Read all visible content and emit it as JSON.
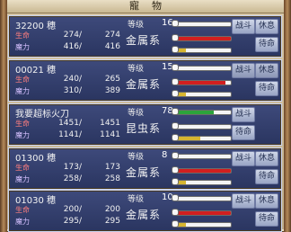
{
  "window": {
    "title": "寵物"
  },
  "labels": {
    "hp": "生命",
    "mp": "魔力",
    "level": "等级"
  },
  "buttons": {
    "battle": "战斗",
    "rest": "休息",
    "standby": "待命"
  },
  "colors": {
    "panel": "#2f3b6d",
    "hp_bar": "#d11f1f",
    "mp_bar": "#d6b530",
    "xp_bar": "#2ca33a"
  },
  "pets": [
    {
      "name": "32200 穗",
      "level": "16",
      "hp": "274/",
      "hp_max": "274",
      "mp": "416/",
      "mp_max": "416",
      "element": "金属系",
      "hp_fill": 1.0,
      "mp_fill": 0.2,
      "xp_fill": 0.05
    },
    {
      "name": "00021 穗",
      "level": "15",
      "hp": "240/",
      "hp_max": "265",
      "mp": "310/",
      "mp_max": "389",
      "element": "金属系",
      "hp_fill": 0.9,
      "mp_fill": 0.2,
      "xp_fill": 0.05
    },
    {
      "name": "我要超标火刀",
      "level": "78",
      "hp": "1451/",
      "hp_max": "1451",
      "mp": "1141/",
      "mp_max": "1141",
      "element": "昆虫系",
      "hp_fill": 0.0,
      "mp_fill": 0.45,
      "xp_fill": 0.7
    },
    {
      "name": "01300 穗",
      "level": "8",
      "hp": "173/",
      "hp_max": "173",
      "mp": "258/",
      "mp_max": "258",
      "element": "金属系",
      "hp_fill": 1.0,
      "mp_fill": 0.2,
      "xp_fill": 0.05
    },
    {
      "name": "01030 穗",
      "level": "10",
      "hp": "200/",
      "hp_max": "200",
      "mp": "295/",
      "mp_max": "295",
      "element": "金属系",
      "hp_fill": 1.0,
      "mp_fill": 0.2,
      "xp_fill": 0.05
    }
  ]
}
